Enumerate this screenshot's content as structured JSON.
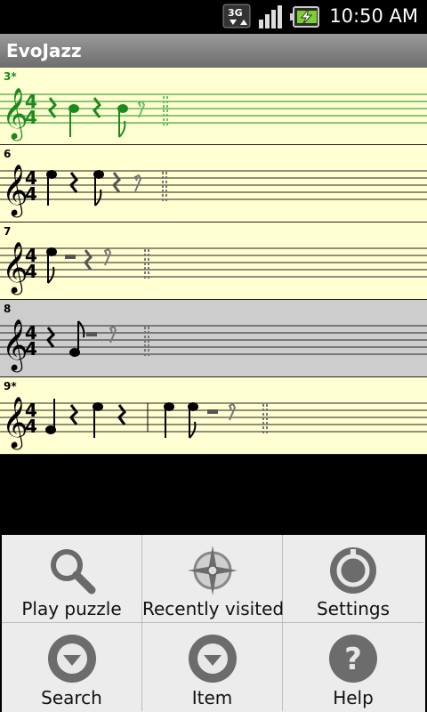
{
  "status_bar": {
    "network": "3G",
    "time": "10:50 AM",
    "icons": [
      "3g-icon",
      "signal-icon",
      "battery-charging-icon"
    ]
  },
  "app": {
    "title": "EvoJazz"
  },
  "staves": [
    {
      "label": "3*",
      "state": "current"
    },
    {
      "label": "6",
      "state": "normal"
    },
    {
      "label": "7",
      "state": "normal"
    },
    {
      "label": "8",
      "state": "selected"
    },
    {
      "label": "9*",
      "state": "normal"
    }
  ],
  "menu": {
    "items": [
      {
        "label": "Play puzzle",
        "icon": "magnifier-icon"
      },
      {
        "label": "Recently visited",
        "icon": "compass-icon"
      },
      {
        "label": "Settings",
        "icon": "gear-icon"
      },
      {
        "label": "Search",
        "icon": "down-arrow-icon"
      },
      {
        "label": "Item",
        "icon": "down-arrow-icon"
      },
      {
        "label": "Help",
        "icon": "help-icon"
      }
    ]
  },
  "colors": {
    "staff_bg": "#ffffd2",
    "selected_bg": "#cdcdcd",
    "current_note": "#1b8a1b",
    "menu_bg": "#ececec"
  }
}
